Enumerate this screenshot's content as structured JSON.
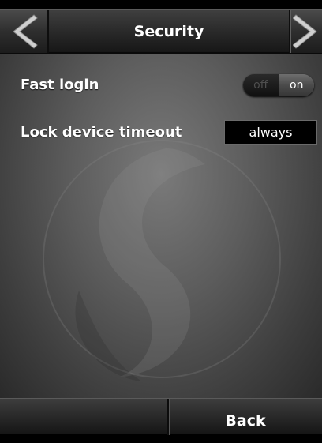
{
  "header": {
    "title": "Security",
    "back_icon": "chevron-left-icon",
    "forward_icon": "chevron-right-icon"
  },
  "settings": {
    "fast_login": {
      "label": "Fast login",
      "off_label": "off",
      "on_label": "on",
      "state": "on"
    },
    "lock_timeout": {
      "label": "Lock device timeout",
      "value": "always"
    }
  },
  "footer": {
    "left_label": "",
    "right_label": "Back"
  },
  "colors": {
    "text": "#ffffff",
    "bar": "#2c2c2c",
    "select_bg": "#000000"
  }
}
